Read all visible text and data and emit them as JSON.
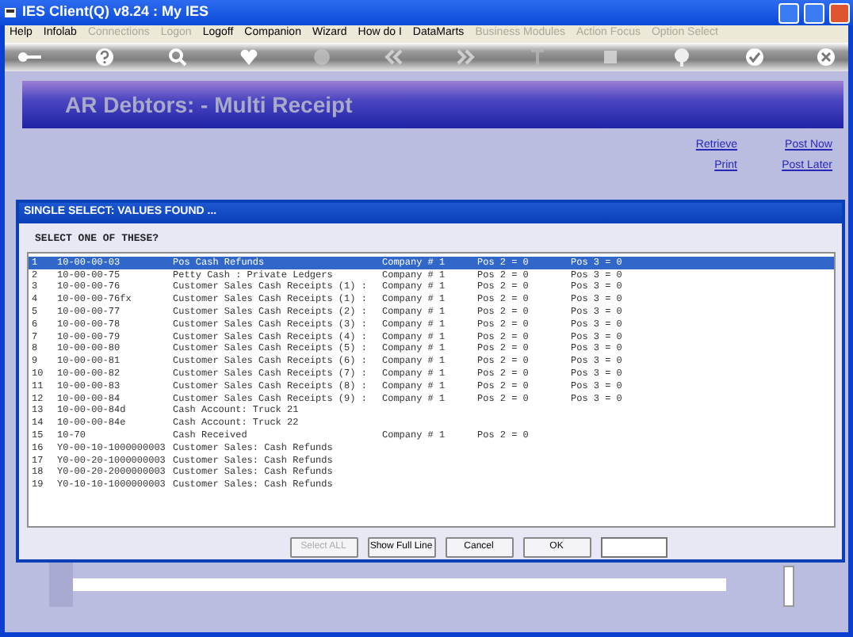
{
  "window": {
    "title": "IES Client(Q) v8.24 : My IES"
  },
  "menu": [
    {
      "label": "Help",
      "disabled": false
    },
    {
      "label": "Infolab",
      "disabled": false
    },
    {
      "label": "Connections",
      "disabled": true
    },
    {
      "label": "Logon",
      "disabled": true
    },
    {
      "label": "Logoff",
      "disabled": false
    },
    {
      "label": "Companion",
      "disabled": false
    },
    {
      "label": "Wizard",
      "disabled": false
    },
    {
      "label": "How do I",
      "disabled": false
    },
    {
      "label": "DataMarts",
      "disabled": false
    },
    {
      "label": "Business Modules",
      "disabled": true
    },
    {
      "label": "Action Focus",
      "disabled": true
    },
    {
      "label": "Option Select",
      "disabled": true
    }
  ],
  "banner": {
    "title": "AR Debtors: - Multi Receipt"
  },
  "links": [
    "Retrieve",
    "Post Now",
    "Print",
    "Post Later"
  ],
  "dialog": {
    "title": "SINGLE SELECT: VALUES FOUND ...",
    "prompt": "SELECT ONE OF THESE?",
    "rows": [
      {
        "number": "1",
        "code": "10-00-00-03",
        "description": "Pos Cash Refunds",
        "company": "Company # 1",
        "pos2": "Pos 2 = 0",
        "pos3": "Pos 3 = 0",
        "selected": true
      },
      {
        "number": "2",
        "code": "10-00-00-75",
        "description": "Petty Cash : Private Ledgers",
        "company": "Company # 1",
        "pos2": "Pos 2 = 0",
        "pos3": "Pos 3 = 0",
        "selected": false
      },
      {
        "number": "3",
        "code": "10-00-00-76",
        "description": "Customer Sales Cash Receipts (1) :",
        "company": "Company # 1",
        "pos2": "Pos 2 = 0",
        "pos3": "Pos 3 = 0",
        "selected": false
      },
      {
        "number": "4",
        "code": "10-00-00-76fx",
        "description": "Customer Sales Cash Receipts (1) :",
        "company": "Company # 1",
        "pos2": "Pos 2 = 0",
        "pos3": "Pos 3 = 0",
        "selected": false
      },
      {
        "number": "5",
        "code": "10-00-00-77",
        "description": "Customer Sales Cash Receipts (2) :",
        "company": "Company # 1",
        "pos2": "Pos 2 = 0",
        "pos3": "Pos 3 = 0",
        "selected": false
      },
      {
        "number": "6",
        "code": "10-00-00-78",
        "description": "Customer Sales Cash Receipts (3) :",
        "company": "Company # 1",
        "pos2": "Pos 2 = 0",
        "pos3": "Pos 3 = 0",
        "selected": false
      },
      {
        "number": "7",
        "code": "10-00-00-79",
        "description": "Customer Sales Cash Receipts (4) :",
        "company": "Company # 1",
        "pos2": "Pos 2 = 0",
        "pos3": "Pos 3 = 0",
        "selected": false
      },
      {
        "number": "8",
        "code": "10-00-00-80",
        "description": "Customer Sales Cash Receipts (5) :",
        "company": "Company # 1",
        "pos2": "Pos 2 = 0",
        "pos3": "Pos 3 = 0",
        "selected": false
      },
      {
        "number": "9",
        "code": "10-00-00-81",
        "description": "Customer Sales Cash Receipts (6) :",
        "company": "Company # 1",
        "pos2": "Pos 2 = 0",
        "pos3": "Pos 3 = 0",
        "selected": false
      },
      {
        "number": "10",
        "code": "10-00-00-82",
        "description": "Customer Sales Cash Receipts (7) :",
        "company": "Company # 1",
        "pos2": "Pos 2 = 0",
        "pos3": "Pos 3 = 0",
        "selected": false
      },
      {
        "number": "11",
        "code": "10-00-00-83",
        "description": "Customer Sales Cash Receipts (8) :",
        "company": "Company # 1",
        "pos2": "Pos 2 = 0",
        "pos3": "Pos 3 = 0",
        "selected": false
      },
      {
        "number": "12",
        "code": "10-00-00-84",
        "description": "Customer Sales Cash Receipts (9) :",
        "company": "Company # 1",
        "pos2": "Pos 2 = 0",
        "pos3": "Pos 3 = 0",
        "selected": false
      },
      {
        "number": "13",
        "code": "10-00-00-84d",
        "description": "Cash Account: Truck 21",
        "selected": false
      },
      {
        "number": "14",
        "code": "10-00-00-84e",
        "description": "Cash Account: Truck 22",
        "selected": false
      },
      {
        "number": "15",
        "code": "10-70",
        "description": "Cash Received",
        "company": "Company # 1",
        "pos2": "Pos 2 = 0",
        "selected": false
      },
      {
        "number": "16",
        "code": "Y0-00-10-1000000003",
        "description": "Customer Sales: Cash Refunds",
        "selected": false
      },
      {
        "number": "17",
        "code": "Y0-00-20-1000000003",
        "description": "Customer Sales: Cash Refunds",
        "selected": false
      },
      {
        "number": "18",
        "code": "Y0-00-20-2000000003",
        "description": "Customer Sales: Cash Refunds",
        "selected": false
      },
      {
        "number": "19",
        "code": "Y0-10-10-1000000003",
        "description": "Customer Sales: Cash Refunds",
        "selected": false
      }
    ],
    "buttons": [
      {
        "label": "Select ALL",
        "disabled": true
      },
      {
        "label": "Show Full Line",
        "disabled": false
      },
      {
        "label": "Cancel",
        "disabled": false
      },
      {
        "label": "OK",
        "disabled": false
      }
    ]
  }
}
